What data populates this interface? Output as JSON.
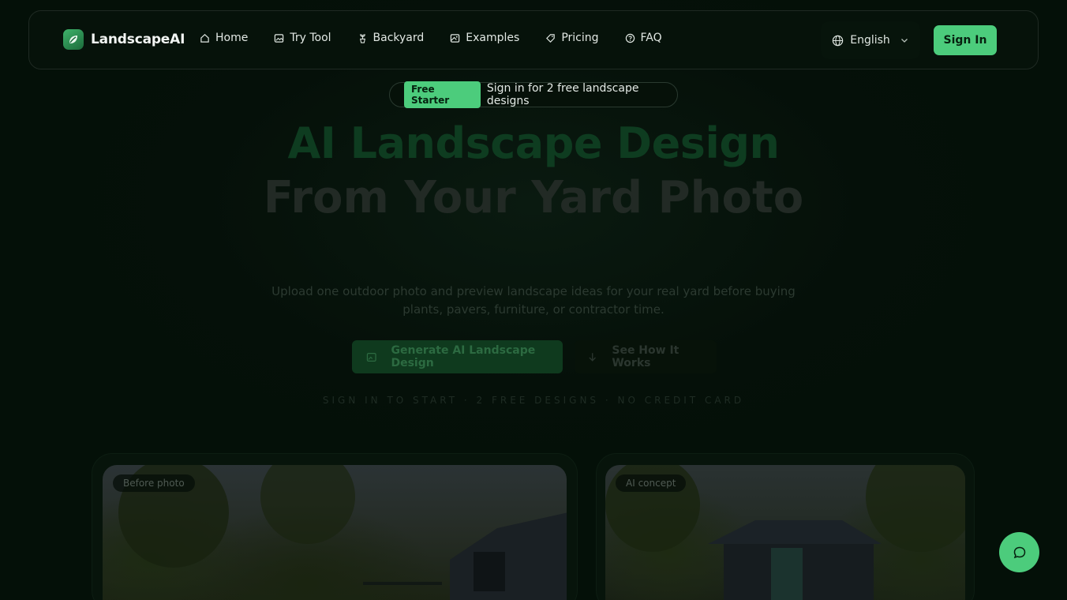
{
  "brand": {
    "name": "LandscapeAI"
  },
  "nav": {
    "items": [
      {
        "label": "Home",
        "icon": "home-icon"
      },
      {
        "label": "Try Tool",
        "icon": "image-icon"
      },
      {
        "label": "Backyard",
        "icon": "plant-icon"
      },
      {
        "label": "Examples",
        "icon": "gallery-icon"
      },
      {
        "label": "Pricing",
        "icon": "tag-icon"
      },
      {
        "label": "FAQ",
        "icon": "help-circle-icon"
      }
    ],
    "language": "English",
    "signin_label": "Sign In"
  },
  "promo": {
    "badge": "Free Starter",
    "text": "Sign in for 2 free landscape designs"
  },
  "hero": {
    "title_line1": "AI Landscape Design",
    "title_line2": "From Your Yard Photo",
    "subtitle": "Upload one outdoor photo and preview landscape ideas for your real yard before buying plants, pavers, furniture, or contractor time.",
    "primary_cta": "Generate AI Landscape Design",
    "secondary_cta": "See How It Works",
    "tagline": "SIGN IN TO START · 2 FREE DESIGNS · NO CREDIT CARD"
  },
  "showcase": {
    "before_label": "Before photo",
    "after_label": "AI concept"
  },
  "colors": {
    "accent": "#4ccc7c",
    "background": "#041008"
  }
}
